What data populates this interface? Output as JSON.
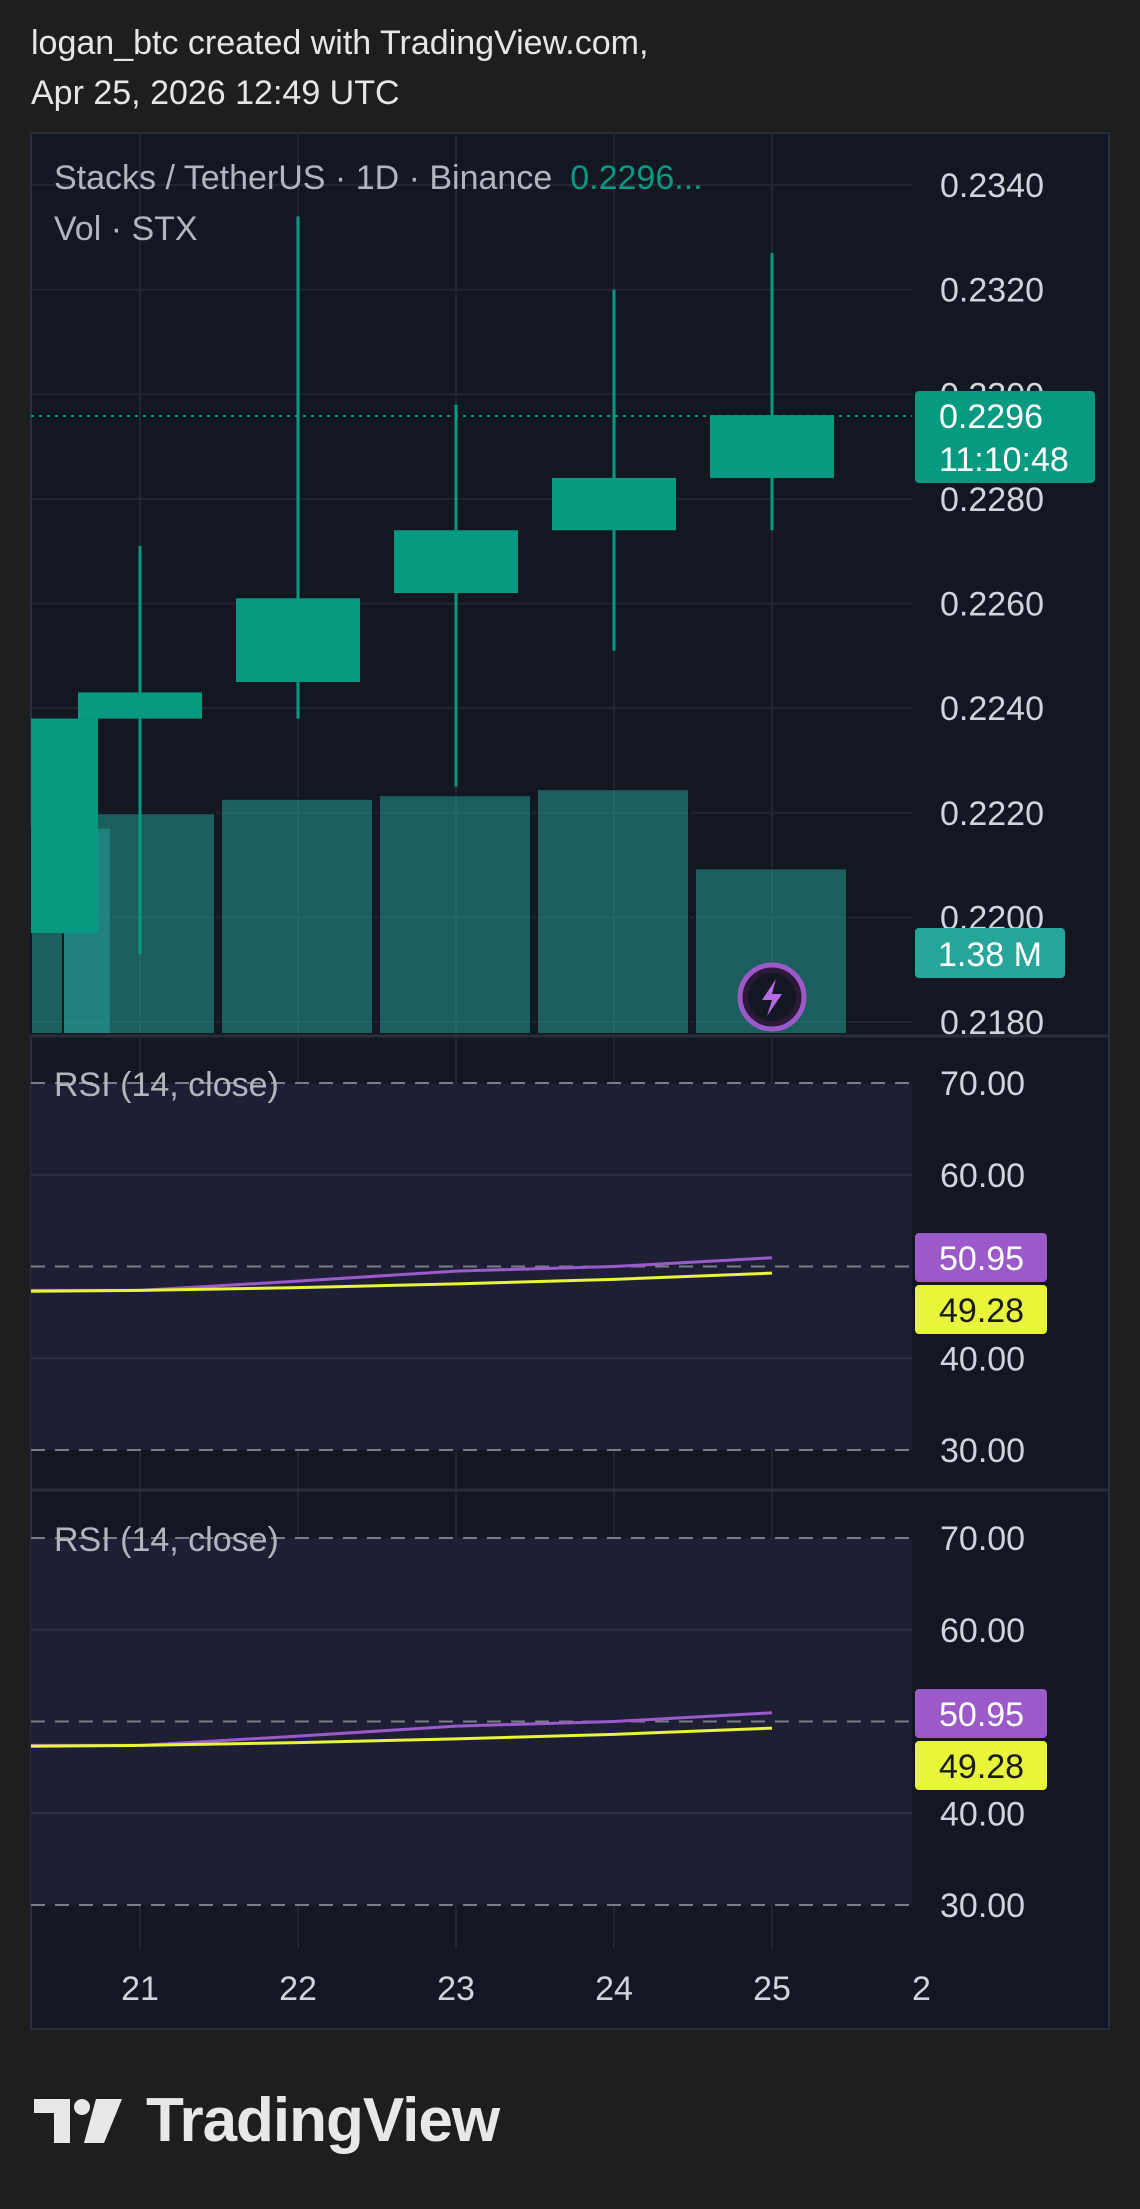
{
  "header": {
    "line1": "logan_btc created with TradingView.com,",
    "line2": "Apr 25, 2026 12:49 UTC"
  },
  "legend": {
    "symbol_line": "Stacks / TetherUS · 1D · Binance",
    "last_price_text": "0.2296...",
    "volume_line": "Vol · STX"
  },
  "price_axis": {
    "tick_labels": [
      "0.2340",
      "0.2320",
      "0.2300",
      "0.2280",
      "0.2260",
      "0.2240",
      "0.2220",
      "0.2200",
      "0.2180"
    ]
  },
  "last_price_badge": {
    "price": "0.2296",
    "countdown": "11:10:48"
  },
  "volume_badge": {
    "value": "1.38 M"
  },
  "rsi_panels": [
    {
      "label": "RSI (14, close)",
      "tick_labels": [
        "70.00",
        "60.00",
        "40.00",
        "30.00"
      ],
      "rsi_badge": "50.95",
      "ma_badge": "49.28"
    },
    {
      "label": "RSI (14, close)",
      "tick_labels": [
        "70.00",
        "60.00",
        "40.00",
        "30.00"
      ],
      "rsi_badge": "50.95",
      "ma_badge": "49.28"
    }
  ],
  "time_axis": {
    "labels": [
      "21",
      "22",
      "23",
      "24",
      "25",
      "2"
    ]
  },
  "footer": {
    "brand": "TradingView"
  },
  "colors": {
    "up": "#089981",
    "volume": "#26a69a",
    "rsi": "#9c59c9",
    "rsi_ma": "#e7f53b",
    "pane_bg": "#131722",
    "rsi_band": "#1e1f35"
  },
  "chart_data": {
    "type": "candlestick",
    "title": "Stacks / TetherUS · 1D · Binance",
    "x": [
      "20",
      "21",
      "22",
      "23",
      "24",
      "25"
    ],
    "ohlc": [
      {
        "x": "20",
        "open": 0.2197,
        "high": 0.2238,
        "low": 0.2197,
        "close": 0.2238
      },
      {
        "x": "21",
        "open": 0.2238,
        "high": 0.2271,
        "low": 0.2193,
        "close": 0.2243
      },
      {
        "x": "22",
        "open": 0.2245,
        "high": 0.2334,
        "low": 0.2238,
        "close": 0.2261
      },
      {
        "x": "23",
        "open": 0.2262,
        "high": 0.2298,
        "low": 0.2225,
        "close": 0.2274
      },
      {
        "x": "24",
        "open": 0.2274,
        "high": 0.232,
        "low": 0.2251,
        "close": 0.2284
      },
      {
        "x": "25",
        "open": 0.2284,
        "high": 0.2327,
        "low": 0.2274,
        "close": 0.2296
      }
    ],
    "volume": [
      1.72,
      1.84,
      1.96,
      1.99,
      2.04,
      1.38
    ],
    "volume_units": "M STX",
    "ylim": [
      0.218,
      0.234
    ],
    "rsi": {
      "upper_band": 70,
      "middle_band": 50,
      "lower_band": 30,
      "rsi_values": [
        47.4,
        47.4,
        48.4,
        49.5,
        50.0,
        50.95
      ],
      "ma_values": [
        47.3,
        47.4,
        47.7,
        48.1,
        48.6,
        49.28
      ]
    }
  }
}
